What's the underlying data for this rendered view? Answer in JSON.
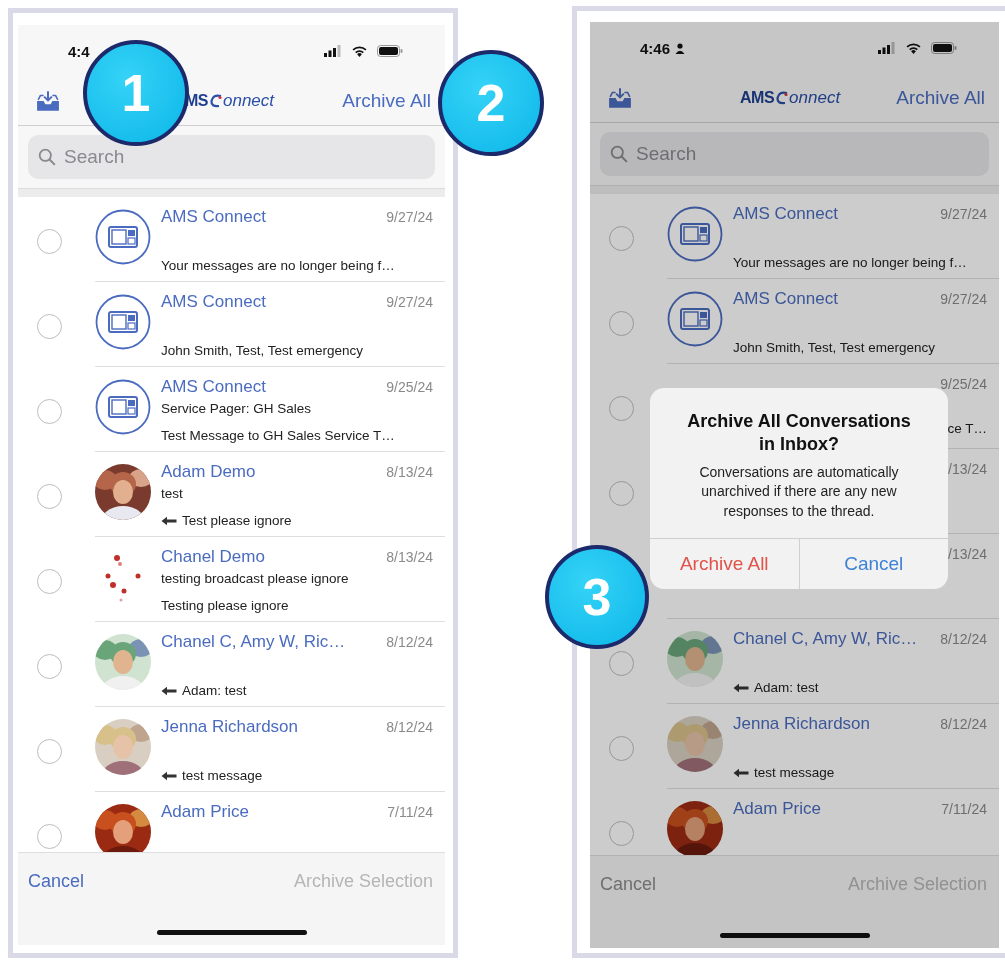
{
  "phones": [
    {
      "dimmed": false,
      "status": {
        "time": "4:4"
      },
      "nav": {
        "logo_bold": "MS",
        "logo_rest": "onnect",
        "action": "Archive All"
      },
      "search": {
        "placeholder": "Search"
      },
      "conversations": [
        {
          "kind": "app",
          "selected": false,
          "name": "AMS Connect",
          "date": "9/27/24",
          "line2": "Your messages are no longer being f…"
        },
        {
          "kind": "app",
          "selected": false,
          "name": "AMS Connect",
          "date": "9/27/24",
          "line2": "John Smith, Test, Test emergency"
        },
        {
          "kind": "app",
          "selected": false,
          "name": "AMS Connect",
          "date": "9/25/24",
          "line1": "Service Pager: GH Sales",
          "line2": "Test Message to GH Sales Service T…"
        },
        {
          "selected": false,
          "name": "Adam Demo",
          "date": "8/13/24",
          "line1": "test",
          "line2": "Test please ignore",
          "reply": true
        },
        {
          "kind": "graphic",
          "selected": false,
          "name": "Chanel Demo",
          "date": "8/13/24",
          "line1": "testing broadcast please ignore",
          "line2": "Testing please ignore"
        },
        {
          "selected": false,
          "name": "Chanel C, Amy W, Ric…",
          "date": "8/12/24",
          "line2": "Adam: test",
          "reply": true
        },
        {
          "selected": false,
          "name": "Jenna Richardson",
          "date": "8/12/24",
          "line2": "test message",
          "reply": true
        },
        {
          "selected": false,
          "name": "Adam Price",
          "date": "7/11/24"
        }
      ],
      "footer": {
        "cancel": "Cancel",
        "archive_selection": {
          "label": "Archive Selection",
          "disabled": true
        }
      }
    },
    {
      "dimmed": true,
      "status": {
        "time": "4:46",
        "person_icon": true
      },
      "nav": {
        "logo_bold": "AMS",
        "logo_rest": "onnect",
        "action": "Archive All"
      },
      "search": {
        "placeholder": "Search"
      },
      "conversations": [
        {
          "kind": "app",
          "selected": false,
          "name": "AMS Connect",
          "date": "9/27/24",
          "line2": "Your messages are no longer being f…"
        },
        {
          "kind": "app",
          "selected": false,
          "name": "AMS Connect",
          "date": "9/27/24",
          "line2": "John Smith, Test, Test emergency"
        },
        {
          "kind": "covered",
          "selected": false,
          "date": "9/25/24",
          "line2": "ce T…"
        },
        {
          "kind": "covered",
          "selected": false,
          "date": "/13/24"
        },
        {
          "kind": "covered",
          "date": "/13/24"
        },
        {
          "selected": false,
          "name": "Chanel C, Amy W, Ric…",
          "date": "8/12/24",
          "line2": "Adam: test",
          "reply": true
        },
        {
          "selected": false,
          "name": "Jenna Richardson",
          "date": "8/12/24",
          "line2": "test message",
          "reply": true
        },
        {
          "selected": false,
          "name": "Adam Price",
          "date": "7/11/24"
        }
      ],
      "footer": {
        "cancel": "Cancel",
        "archive_selection": {
          "label": "Archive Selection",
          "disabled": true
        }
      },
      "dialog": {
        "title": "Archive All Conversations in Inbox?",
        "message": "Conversations are automatically unarchived if there are any new responses to the thread.",
        "buttons": [
          {
            "label": "Archive All",
            "kind": "destructive"
          },
          {
            "label": "Cancel",
            "kind": "default"
          }
        ]
      }
    }
  ],
  "callouts": [
    {
      "number": "1"
    },
    {
      "number": "2"
    },
    {
      "number": "3"
    }
  ]
}
